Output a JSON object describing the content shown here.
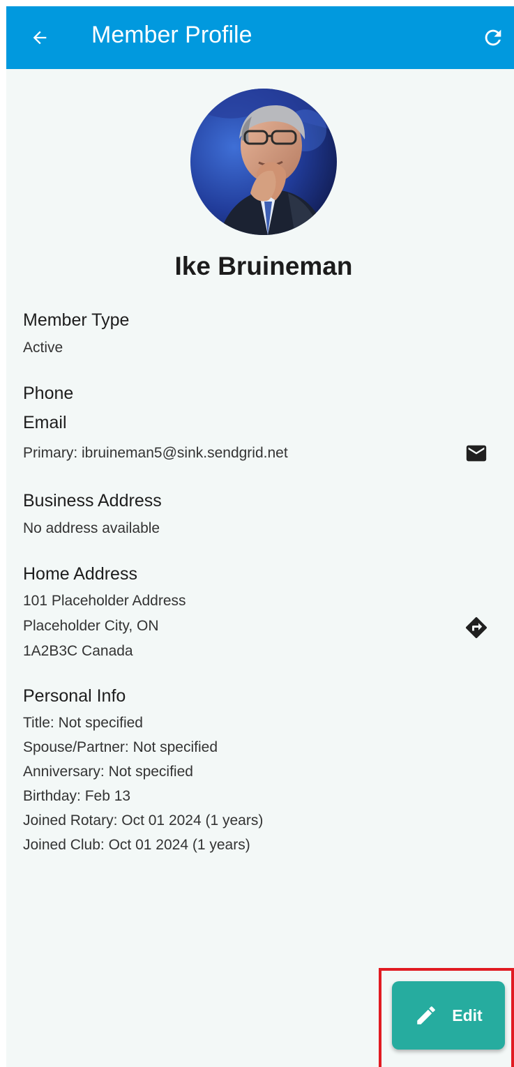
{
  "appbar": {
    "title": "Member Profile",
    "back_icon": "arrow-left-icon",
    "refresh_icon": "refresh-icon",
    "color": "#0199de"
  },
  "profile": {
    "name": "Ike Bruineman",
    "avatar_icon": "member-photo"
  },
  "member_type": {
    "title": "Member Type",
    "value": "Active"
  },
  "phone": {
    "title": "Phone"
  },
  "email": {
    "title": "Email",
    "primary_label": "Primary:",
    "primary_value": "ibruineman5@sink.sendgrid.net",
    "icon": "mail-icon"
  },
  "business_address": {
    "title": "Business Address",
    "value": "No address available"
  },
  "home_address": {
    "title": "Home Address",
    "lines": [
      "101 Placeholder Address",
      "Placeholder City, ON",
      "1A2B3C Canada"
    ],
    "icon": "directions-icon"
  },
  "personal_info": {
    "title": "Personal Info",
    "rows": [
      {
        "label": "Title:",
        "value": "Not specified"
      },
      {
        "label": "Spouse/Partner:",
        "value": "Not specified"
      },
      {
        "label": "Anniversary:",
        "value": "Not specified"
      },
      {
        "label": "Birthday:",
        "value": "Feb 13"
      },
      {
        "label": "Joined Rotary:",
        "value": "Oct 01 2024 (1 years)"
      },
      {
        "label": "Joined Club:",
        "value": "Oct 01 2024 (1 years)"
      }
    ]
  },
  "fab": {
    "label": "Edit",
    "icon": "pencil-icon",
    "color": "#26ac9f",
    "highlight_color": "#e11b22"
  }
}
